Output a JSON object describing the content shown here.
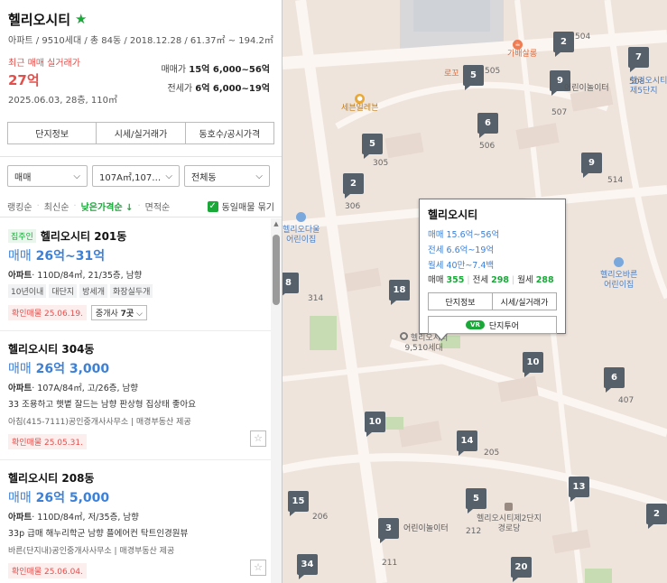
{
  "complex": {
    "name": "헬리오시티",
    "info": "아파트 / 9510세대 / 총 84동 / 2018.12.28 / 61.37㎡ ~ 194.2㎡",
    "recent_label": "최근 매매 실거래가",
    "recent_price": "27억",
    "recent_date": "2025.06.03, 28층, 110㎡",
    "sale_label": "매매가",
    "sale_range": "15억 6,000~56억",
    "jeonse_label": "전세가",
    "jeonse_range": "6억 6,000~19억"
  },
  "tabs": [
    "단지정보",
    "시세/실거래가",
    "동호수/공시가격"
  ],
  "filters": {
    "trade_type": "매매",
    "area": "107A㎡,107…",
    "dong": "전체동"
  },
  "sort": {
    "items": [
      "랭킹순",
      "최신순",
      "낮은가격순 ↓",
      "면적순"
    ],
    "group_label": "동일매물 묶기"
  },
  "listings": [
    {
      "owner_tag": "집주인",
      "title": "헬리오시티 201동",
      "type": "매매",
      "price": "26억~31억",
      "spec_type": "아파트",
      "spec": "· 110D/84㎡, 21/35층, 남향",
      "tags": [
        "10년이내",
        "대단지",
        "방세개",
        "화장실두개"
      ],
      "confirm": "확인매물 25.06.19.",
      "agents_label": "중개사",
      "agents_count": "7곳"
    },
    {
      "title": "헬리오시티 304동",
      "type": "매매",
      "price": "26억 3,000",
      "spec_type": "아파트",
      "spec": "· 107A/84㎡, 고/26층, 남향",
      "desc": "33 조용하고 햇볕 잘드는 남향 판상형 집상태 좋아요",
      "agent": "아침(415-7111)공인중개사사무소 | 매경부동산 제공",
      "confirm": "확인매물 25.05.31."
    },
    {
      "title": "헬리오시티 208동",
      "type": "매매",
      "price": "26억 5,000",
      "spec_type": "아파트",
      "spec": "· 110D/84㎡, 저/35층, 남향",
      "desc": "33p 급매 해누리학군 남향 플에어컨 탁트인경원뷰",
      "agent": "바른(단지내)공인중개사사무소 | 매경부동산 제공",
      "confirm": "확인매물 25.06.04."
    }
  ],
  "map": {
    "pins": [
      "2",
      "5",
      "9",
      "7",
      "6",
      "5",
      "2",
      "9",
      "8",
      "18",
      "10",
      "6",
      "10",
      "14",
      "15",
      "5",
      "13",
      "3",
      "34",
      "20",
      "2"
    ],
    "dong_labels": [
      "504",
      "505",
      "508",
      "507",
      "506",
      "305",
      "514",
      "306",
      "314",
      "407",
      "205",
      "206",
      "212",
      "211"
    ],
    "poi": {
      "gabae": "가배살롱",
      "rogue": "로꼬",
      "seben": "세븐일레븐",
      "kinder1": "어린이놀이터",
      "kinder_daul_1": "헬리오다울",
      "kinder_daul_2": "어린이집",
      "kinder_bareun_1": "헬리오바른",
      "kinder_bareun_2": "어린이집",
      "school5_1": "헬리오시티",
      "school5_2": "제5단지",
      "complex_1": "헬리오시티",
      "complex_2": "9,510세대",
      "kinder2": "어린이놀이터",
      "senior_1": "헬리오시티제2단지",
      "senior_2": "경로당"
    },
    "popup": {
      "title": "헬리오시티",
      "sale": "매매 15.6억~56억",
      "jeonse": "전세 6.6억~19억",
      "monthly": "월세 40만~7.4백",
      "sale_count_label": "매매",
      "sale_count": "355",
      "jeonse_count_label": "전세",
      "jeonse_count": "298",
      "monthly_count_label": "월세",
      "monthly_count": "288",
      "btn_info": "단지정보",
      "btn_price": "시세/실거래가",
      "vr": "VR",
      "tour": "단지투어"
    }
  },
  "colors": {
    "accent_green": "#1aa839",
    "price_blue": "#3d80d6",
    "alert_red": "#e2504c",
    "pin": "#55606b",
    "map_bg": "#efe4dc"
  }
}
